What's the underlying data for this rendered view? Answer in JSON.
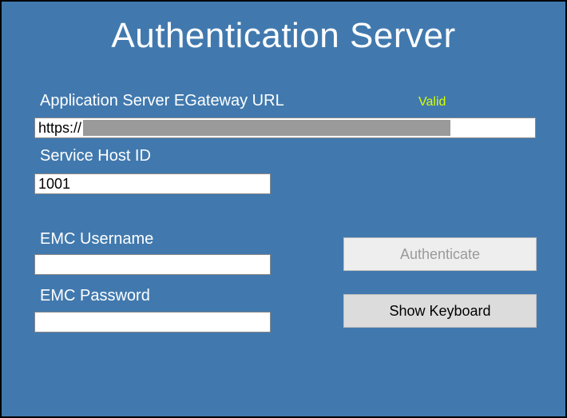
{
  "title": "Authentication Server",
  "url_section": {
    "label": "Application Server EGateway URL",
    "status": "Valid",
    "prefix_text": "https://"
  },
  "service_host": {
    "label": "Service Host ID",
    "value": "1001"
  },
  "username": {
    "label": "EMC Username",
    "value": ""
  },
  "password": {
    "label": "EMC Password",
    "value": ""
  },
  "buttons": {
    "authenticate": "Authenticate",
    "show_keyboard": "Show Keyboard"
  }
}
